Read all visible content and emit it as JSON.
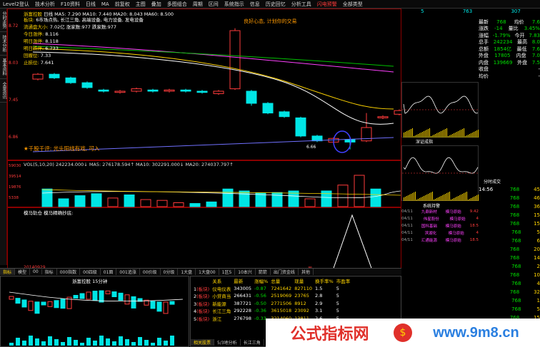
{
  "menubar": {
    "items": [
      {
        "label": "Level2登认",
        "red": false
      },
      {
        "label": "技术分析",
        "red": false
      },
      {
        "label": "F10资料",
        "red": false
      },
      {
        "label": "日线",
        "red": false
      },
      {
        "label": "MA",
        "red": false
      },
      {
        "label": "前复权",
        "red": false
      },
      {
        "label": "主图",
        "red": false
      },
      {
        "label": "叠加",
        "red": false
      },
      {
        "label": "多图组合",
        "red": false
      },
      {
        "label": "周期",
        "red": false
      },
      {
        "label": "区间",
        "red": false
      },
      {
        "label": "系统指示",
        "red": false
      },
      {
        "label": "信息",
        "red": false
      },
      {
        "label": "历史回忆",
        "red": false
      },
      {
        "label": "分析工具",
        "red": false
      },
      {
        "label": "闪电预警",
        "red": true
      },
      {
        "label": "全部类型",
        "red": false
      }
    ]
  },
  "left_tabs": [
    "分时走势",
    "技术分析",
    "基本资料",
    "全景资讯"
  ],
  "main": {
    "title": "浙富控股",
    "period": "日线",
    "ma_line": "MA5: 7.290  MA10: 7.440  MA20: 8.043  MA60: 8.500",
    "info_lines": [
      {
        "label": "板块:",
        "value": "6市场点热, 长江三角, 高端设备, 电力设备, 发电设备"
      },
      {
        "label": "流通盘大小:",
        "value": "7.02亿  涨家数:977  跌家数:977"
      },
      {
        "label": "今日涨停:",
        "value": "8.116"
      },
      {
        "label": "明日涨停:",
        "value": "8.118"
      },
      {
        "label": "明日跌停:",
        "value": "6.733"
      },
      {
        "label": "回撤位:",
        "value": "7.33"
      },
      {
        "label": "止损位:",
        "value": "7.641"
      }
    ],
    "slogan": "良好心态, 计划你的交易",
    "stars": "★千股千评: 光头阳线有戏, 可入",
    "low_label": "6.66",
    "y_labels": [
      "8.72",
      "8.03",
      "7.45",
      "6.86"
    ]
  },
  "volume": {
    "header": "VOL(5,10,20)  242234.000↓  MA5: 276178.594↑  MA10: 302291.000↓  MA20: 274037.797↑",
    "y_labels": [
      "59030",
      "39514",
      "19876",
      "5338"
    ],
    "bars": [
      {
        "v": 0.45,
        "up": false
      },
      {
        "v": 0.2,
        "up": false
      },
      {
        "v": 0.28,
        "up": false
      },
      {
        "v": 0.33,
        "up": false
      },
      {
        "v": 0.22,
        "up": true
      },
      {
        "v": 0.3,
        "up": false
      },
      {
        "v": 0.18,
        "up": true
      },
      {
        "v": 0.16,
        "up": true
      },
      {
        "v": 0.1,
        "up": true
      },
      {
        "v": 0.08,
        "up": false
      },
      {
        "v": 0.12,
        "up": false
      },
      {
        "v": 0.45,
        "up": false
      },
      {
        "v": 0.4,
        "up": false
      },
      {
        "v": 0.35,
        "up": false
      },
      {
        "v": 0.36,
        "up": false
      },
      {
        "v": 0.4,
        "up": false
      },
      {
        "v": 0.2,
        "up": true
      },
      {
        "v": 0.4,
        "up": false
      },
      {
        "v": 0.55,
        "up": true
      },
      {
        "v": 0.8,
        "up": true
      },
      {
        "v": 0.45,
        "up": false
      }
    ]
  },
  "indicator": {
    "header": "模马轨仓   模马精确抄底:",
    "date_label": "20140929",
    "date_label2": "周"
  },
  "tabs": [
    "指标",
    "模型",
    "00",
    "指标",
    "000指数",
    "00四级",
    "01面",
    "001追涨",
    "00价级",
    "0分级",
    "1大盘",
    "1大盘00",
    "1区5",
    "10本兴",
    "箭箭",
    "出门资金线",
    "其他"
  ],
  "sub": {
    "title": "浙富控股 15分钟",
    "list_header": [
      "",
      "关系",
      "最新",
      "涨幅%",
      "总量",
      "现量",
      "换手率%",
      "市盈率"
    ],
    "rows": [
      {
        "n": "1",
        "tag": "(板块)",
        "name": "仪电仪表",
        "price": "343005",
        "chg": "-0.87",
        "vol": "7241642",
        "cur": "827110",
        "turn": "1.5",
        "pe": "5"
      },
      {
        "n": "2",
        "tag": "(板块)",
        "name": "小贷商当",
        "price": "266431",
        "chg": "-0.56",
        "vol": "2519069",
        "cur": "23765",
        "turn": "2.8",
        "pe": "5"
      },
      {
        "n": "3",
        "tag": "(板块)",
        "name": "新能源",
        "price": "387721",
        "chg": "-0.50",
        "vol": "2771506",
        "cur": "8912",
        "turn": "2.9",
        "pe": "5"
      },
      {
        "n": "4",
        "tag": "(板块)",
        "name": "长江三角",
        "price": "292228",
        "chg": "-0.36",
        "vol": "3615018",
        "cur": "23092",
        "turn": "3.1",
        "pe": "5"
      },
      {
        "n": "5",
        "tag": "(板块)",
        "name": "浙江",
        "price": "276798",
        "chg": "-0.33",
        "vol": "3214060",
        "cur": "13811",
        "turn": "2.6",
        "pe": "5"
      }
    ],
    "bottom_tabs": [
      "相关股票",
      "5/3地分析",
      "长江三角",
      "涨",
      "TOP板块"
    ]
  },
  "side": {
    "top_nums": [
      "5",
      "763",
      "307"
    ],
    "quote": [
      {
        "k": "最新",
        "v": "768",
        "k2": "均价",
        "v2": "7.6"
      },
      {
        "k": "涨跌",
        "v": "-14",
        "k2": "量比",
        "v2": "3.45%"
      },
      {
        "k": "涨幅",
        "v": "-1.79%",
        "k2": "今开",
        "v2": "7.83"
      },
      {
        "k": "总手",
        "v": "242234",
        "k2": "最高",
        "v2": "8.0"
      },
      {
        "k": "总额",
        "v": "1854亿",
        "k2": "最低",
        "v2": "7.6"
      },
      {
        "k": "外盘",
        "v": "17805",
        "k2": "内盘",
        "v2": "7.0"
      },
      {
        "k": "内盘",
        "v": "139669",
        "k2": "外盘",
        "v2": "7.5"
      }
    ],
    "mini_title": "深证成指",
    "mini_title2": "系统持警",
    "alerts": [
      {
        "t": "04/11",
        "n": "九鼎新材",
        "s": "模马原始",
        "p": "9.42"
      },
      {
        "t": "04/11",
        "n": "伟星股份",
        "s": "模马原始",
        "p": "4"
      },
      {
        "t": "04/11",
        "n": "国科基础",
        "s": "模马原始",
        "p": "18.5"
      },
      {
        "t": "04/11",
        "n": "滨湖化",
        "s": "模马原始",
        "p": "4"
      },
      {
        "t": "04/11",
        "n": "汇通能源",
        "s": "模马原始",
        "p": "18.5"
      }
    ],
    "trade_title": "分时成交",
    "trades": [
      {
        "t": "14:56",
        "p": "768",
        "v": "45"
      },
      {
        "t": "",
        "p": "768",
        "v": "46"
      },
      {
        "t": "",
        "p": "768",
        "v": "36"
      },
      {
        "t": "",
        "p": "768",
        "v": "15"
      },
      {
        "t": "",
        "p": "768",
        "v": "15"
      },
      {
        "t": "",
        "p": "768",
        "v": "5"
      },
      {
        "t": "",
        "p": "768",
        "v": "6"
      },
      {
        "t": "",
        "p": "768",
        "v": "20"
      },
      {
        "t": "",
        "p": "768",
        "v": "14"
      },
      {
        "t": "",
        "p": "768",
        "v": "2"
      },
      {
        "t": "",
        "p": "768",
        "v": "10"
      },
      {
        "t": "",
        "p": "768",
        "v": "4"
      },
      {
        "t": "",
        "p": "768",
        "v": "32"
      },
      {
        "t": "",
        "p": "768",
        "v": "1"
      },
      {
        "t": "",
        "p": "768",
        "v": "5"
      },
      {
        "t": "",
        "p": "768",
        "v": "15"
      }
    ],
    "extra": [
      {
        "k": "收盘",
        "v": "-"
      },
      {
        "k": "均价",
        "v": "-"
      }
    ]
  },
  "banner": {
    "text": "公式指标网",
    "url": "www.9m8.cn"
  },
  "colors": {
    "up": "#ff3b3b",
    "down": "#00e5e5",
    "border": "#8b0000"
  }
}
